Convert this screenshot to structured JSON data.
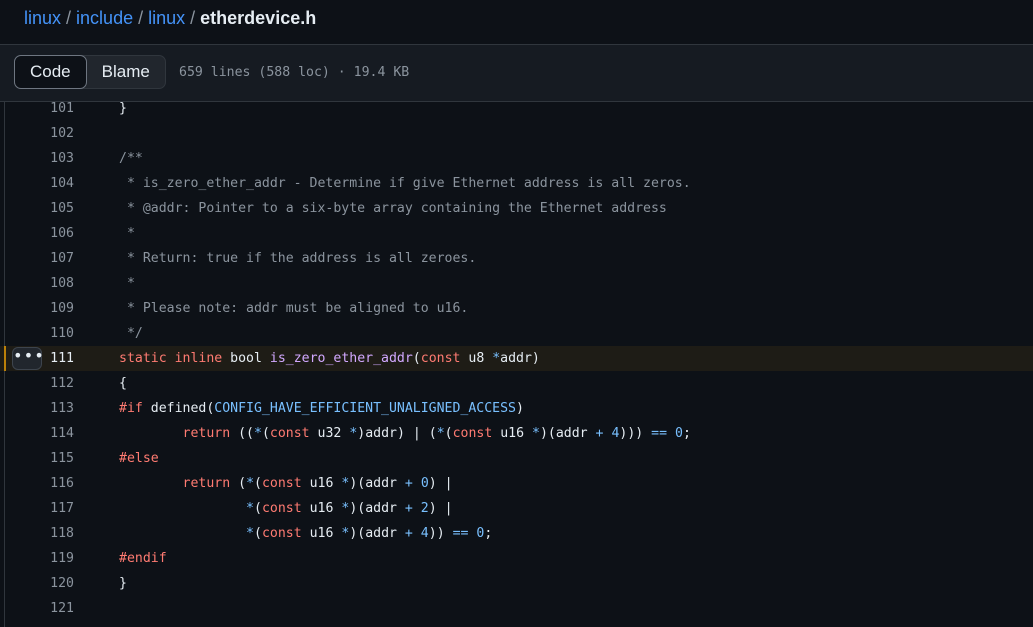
{
  "breadcrumb": {
    "parts": [
      "linux",
      "include",
      "linux"
    ],
    "separator": "/",
    "current": "etherdevice.h"
  },
  "toolbar": {
    "code_label": "Code",
    "blame_label": "Blame",
    "file_meta": "659 lines (588 loc) · 19.4 KB"
  },
  "icons": {
    "line_actions": "kebab-horizontal-icon"
  },
  "colors": {
    "background": "#0d1117",
    "link": "#4493f8",
    "keyword": "#ff7b72",
    "function": "#d2a8ff",
    "constant": "#79c0ff",
    "comment": "#8b949e",
    "highlight_bar": "#bb8009"
  },
  "code": {
    "highlighted_line": 111,
    "lines": [
      {
        "num": "101",
        "tokens": [
          {
            "t": "}",
            "c": ""
          }
        ]
      },
      {
        "num": "102",
        "tokens": []
      },
      {
        "num": "103",
        "tokens": [
          {
            "t": "/**",
            "c": "cm"
          }
        ]
      },
      {
        "num": "104",
        "tokens": [
          {
            "t": " * is_zero_ether_addr - Determine if give Ethernet address is all zeros.",
            "c": "cm"
          }
        ]
      },
      {
        "num": "105",
        "tokens": [
          {
            "t": " * @addr: Pointer to a six-byte array containing the Ethernet address",
            "c": "cm"
          }
        ]
      },
      {
        "num": "106",
        "tokens": [
          {
            "t": " *",
            "c": "cm"
          }
        ]
      },
      {
        "num": "107",
        "tokens": [
          {
            "t": " * Return: true if the address is all zeroes.",
            "c": "cm"
          }
        ]
      },
      {
        "num": "108",
        "tokens": [
          {
            "t": " *",
            "c": "cm"
          }
        ]
      },
      {
        "num": "109",
        "tokens": [
          {
            "t": " * Please note: addr must be aligned to u16.",
            "c": "cm"
          }
        ]
      },
      {
        "num": "110",
        "tokens": [
          {
            "t": " */",
            "c": "cm"
          }
        ]
      },
      {
        "num": "111",
        "tokens": [
          {
            "t": "static",
            "c": "kw"
          },
          {
            "t": " ",
            "c": ""
          },
          {
            "t": "inline",
            "c": "kw"
          },
          {
            "t": " bool ",
            "c": ""
          },
          {
            "t": "is_zero_ether_addr",
            "c": "fn"
          },
          {
            "t": "(",
            "c": ""
          },
          {
            "t": "const",
            "c": "kw"
          },
          {
            "t": " u8 ",
            "c": ""
          },
          {
            "t": "*",
            "c": "op"
          },
          {
            "t": "addr)",
            "c": ""
          }
        ]
      },
      {
        "num": "112",
        "tokens": [
          {
            "t": "{",
            "c": ""
          }
        ]
      },
      {
        "num": "113",
        "tokens": [
          {
            "t": "#if",
            "c": "kw"
          },
          {
            "t": " defined(",
            "c": ""
          },
          {
            "t": "CONFIG_HAVE_EFFICIENT_UNALIGNED_ACCESS",
            "c": "cn"
          },
          {
            "t": ")",
            "c": ""
          }
        ]
      },
      {
        "num": "114",
        "tokens": [
          {
            "t": "        ",
            "c": ""
          },
          {
            "t": "return",
            "c": "kw"
          },
          {
            "t": " ((",
            "c": ""
          },
          {
            "t": "*",
            "c": "op"
          },
          {
            "t": "(",
            "c": ""
          },
          {
            "t": "const",
            "c": "kw"
          },
          {
            "t": " u32 ",
            "c": ""
          },
          {
            "t": "*",
            "c": "op"
          },
          {
            "t": ")addr) ",
            "c": ""
          },
          {
            "t": "|",
            "c": ""
          },
          {
            "t": " (",
            "c": ""
          },
          {
            "t": "*",
            "c": "op"
          },
          {
            "t": "(",
            "c": ""
          },
          {
            "t": "const",
            "c": "kw"
          },
          {
            "t": " u16 ",
            "c": ""
          },
          {
            "t": "*",
            "c": "op"
          },
          {
            "t": ")(addr ",
            "c": ""
          },
          {
            "t": "+",
            "c": "op"
          },
          {
            "t": " ",
            "c": ""
          },
          {
            "t": "4",
            "c": "cn"
          },
          {
            "t": "))) ",
            "c": ""
          },
          {
            "t": "==",
            "c": "op"
          },
          {
            "t": " ",
            "c": ""
          },
          {
            "t": "0",
            "c": "cn"
          },
          {
            "t": ";",
            "c": ""
          }
        ]
      },
      {
        "num": "115",
        "tokens": [
          {
            "t": "#else",
            "c": "kw"
          }
        ]
      },
      {
        "num": "116",
        "tokens": [
          {
            "t": "        ",
            "c": ""
          },
          {
            "t": "return",
            "c": "kw"
          },
          {
            "t": " (",
            "c": ""
          },
          {
            "t": "*",
            "c": "op"
          },
          {
            "t": "(",
            "c": ""
          },
          {
            "t": "const",
            "c": "kw"
          },
          {
            "t": " u16 ",
            "c": ""
          },
          {
            "t": "*",
            "c": "op"
          },
          {
            "t": ")(addr ",
            "c": ""
          },
          {
            "t": "+",
            "c": "op"
          },
          {
            "t": " ",
            "c": ""
          },
          {
            "t": "0",
            "c": "cn"
          },
          {
            "t": ") |",
            "c": ""
          }
        ]
      },
      {
        "num": "117",
        "tokens": [
          {
            "t": "                ",
            "c": ""
          },
          {
            "t": "*",
            "c": "op"
          },
          {
            "t": "(",
            "c": ""
          },
          {
            "t": "const",
            "c": "kw"
          },
          {
            "t": " u16 ",
            "c": ""
          },
          {
            "t": "*",
            "c": "op"
          },
          {
            "t": ")(addr ",
            "c": ""
          },
          {
            "t": "+",
            "c": "op"
          },
          {
            "t": " ",
            "c": ""
          },
          {
            "t": "2",
            "c": "cn"
          },
          {
            "t": ") |",
            "c": ""
          }
        ]
      },
      {
        "num": "118",
        "tokens": [
          {
            "t": "                ",
            "c": ""
          },
          {
            "t": "*",
            "c": "op"
          },
          {
            "t": "(",
            "c": ""
          },
          {
            "t": "const",
            "c": "kw"
          },
          {
            "t": " u16 ",
            "c": ""
          },
          {
            "t": "*",
            "c": "op"
          },
          {
            "t": ")(addr ",
            "c": ""
          },
          {
            "t": "+",
            "c": "op"
          },
          {
            "t": " ",
            "c": ""
          },
          {
            "t": "4",
            "c": "cn"
          },
          {
            "t": ")) ",
            "c": ""
          },
          {
            "t": "==",
            "c": "op"
          },
          {
            "t": " ",
            "c": ""
          },
          {
            "t": "0",
            "c": "cn"
          },
          {
            "t": ";",
            "c": ""
          }
        ]
      },
      {
        "num": "119",
        "tokens": [
          {
            "t": "#endif",
            "c": "kw"
          }
        ]
      },
      {
        "num": "120",
        "tokens": [
          {
            "t": "}",
            "c": ""
          }
        ]
      },
      {
        "num": "121",
        "tokens": []
      }
    ]
  }
}
